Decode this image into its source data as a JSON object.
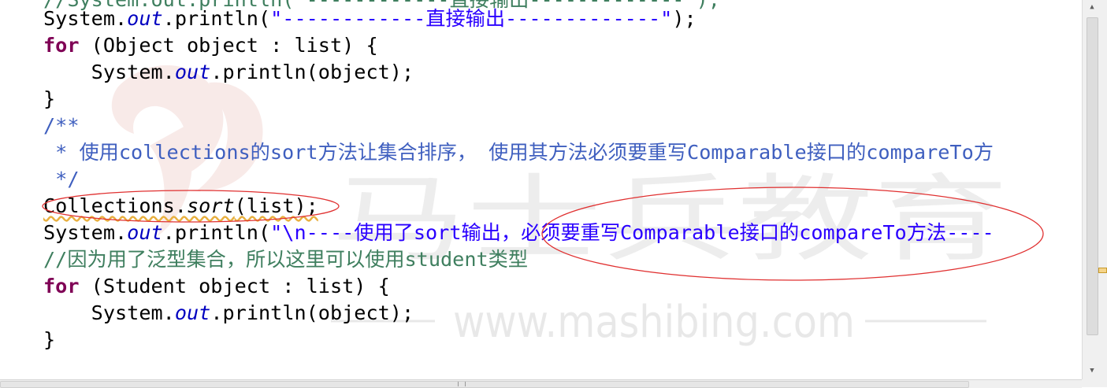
{
  "editor": {
    "top_comment": "//System.out.println(\"------------直接输出-------------\");",
    "line1": {
      "sys": "System.",
      "out": "out",
      "println": ".println(",
      "str": "\"------------直接输出-------------\"",
      "end": ");"
    },
    "line2": {
      "for": "for",
      "rest": " (Object object : list) {"
    },
    "line3": {
      "indent": "    ",
      "sys": "System.",
      "out": "out",
      "rest": ".println(object);"
    },
    "line4": "}",
    "line5": "/**",
    "line6": " * 使用collections的sort方法让集合排序， 使用其方法必须要重写Comparable接口的compareTo方",
    "line7": " */",
    "line8": {
      "cls": "Collections.",
      "method": "sort",
      "rest": "(list);"
    },
    "line9": {
      "sys": "System.",
      "out": "out",
      "println": ".println(",
      "str": "\"\\n----使用了sort输出，必须要重写Comparable接口的compareTo方法----",
      "tail": ""
    },
    "line10": "//因为用了泛型集合，所以这里可以使用student类型",
    "line11": {
      "for": "for",
      "rest": " (Student object : list) {"
    },
    "line12": {
      "indent": "    ",
      "sys": "System.",
      "out": "out",
      "rest": ".println(object);"
    },
    "line13": "}"
  },
  "watermark": {
    "brand": "马士兵教育",
    "url": "www.mashibing.com"
  },
  "scrollbar": {
    "up_arrow": "▲",
    "down_arrow": "▼"
  }
}
